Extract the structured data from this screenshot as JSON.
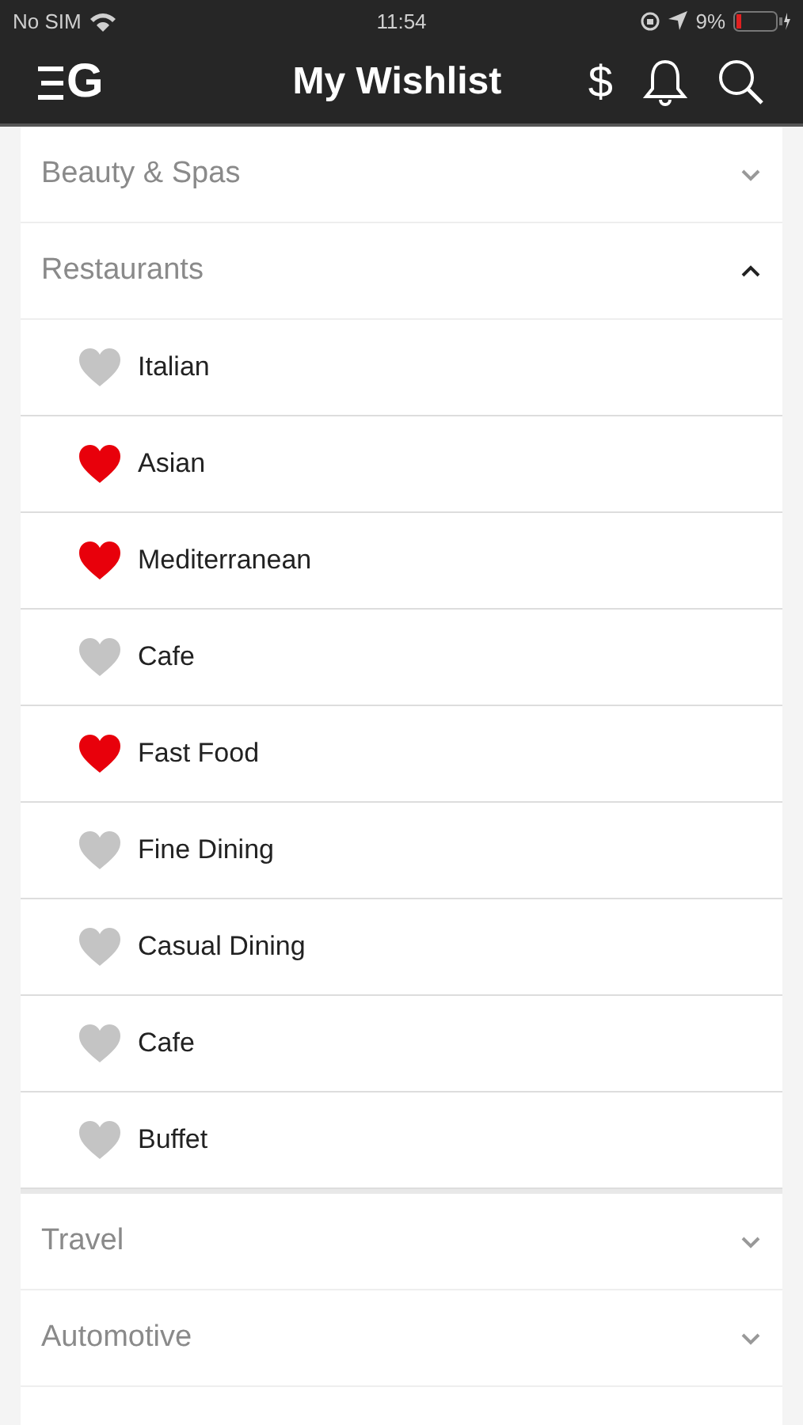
{
  "status_bar": {
    "carrier": "No SIM",
    "time": "11:54",
    "battery": "9%"
  },
  "header": {
    "logo": "G",
    "title": "My Wishlist",
    "currency_symbol": "$"
  },
  "categories": [
    {
      "label": "Beauty & Spas",
      "expanded": false
    },
    {
      "label": "Restaurants",
      "expanded": true,
      "children": [
        {
          "label": "Italian",
          "checked": false
        },
        {
          "label": "Asian",
          "checked": true
        },
        {
          "label": "Mediterranean",
          "checked": true
        },
        {
          "label": "Cafe",
          "checked": false
        },
        {
          "label": "Fast Food",
          "checked": true
        },
        {
          "label": "Fine Dining",
          "checked": false
        },
        {
          "label": "Casual Dining",
          "checked": false
        },
        {
          "label": "Cafe",
          "checked": false
        },
        {
          "label": "Buffet",
          "checked": false
        }
      ]
    },
    {
      "label": "Travel",
      "expanded": false
    },
    {
      "label": "Automotive",
      "expanded": false
    }
  ]
}
